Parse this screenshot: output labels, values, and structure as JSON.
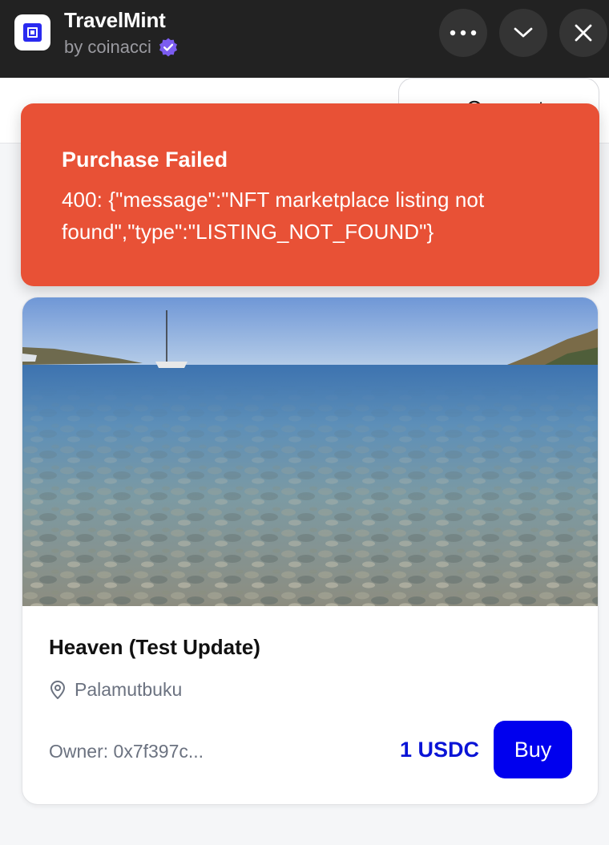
{
  "app": {
    "title": "TravelMint",
    "subtitle": "by coinacci"
  },
  "header": {
    "connect_label": "Connect"
  },
  "toast": {
    "title": "Purchase Failed",
    "message": "400: {\"message\":\"NFT marketplace listing not found\",\"type\":\"LISTING_NOT_FOUND\"}",
    "color": "#e85136"
  },
  "nft": {
    "title": "Heaven (Test Update)",
    "location": "Palamutbuku",
    "owner": "Owner: 0x7f397c...",
    "price": "1 USDC",
    "buy_label": "Buy"
  },
  "icons": {
    "more": "more-horizontal-icon",
    "collapse": "chevron-down-icon",
    "close": "close-icon",
    "verified": "verified-badge-icon",
    "location": "map-pin-icon"
  },
  "colors": {
    "accent": "#0000ee",
    "price": "#0a14d6",
    "verified": "#7b5cf0"
  }
}
